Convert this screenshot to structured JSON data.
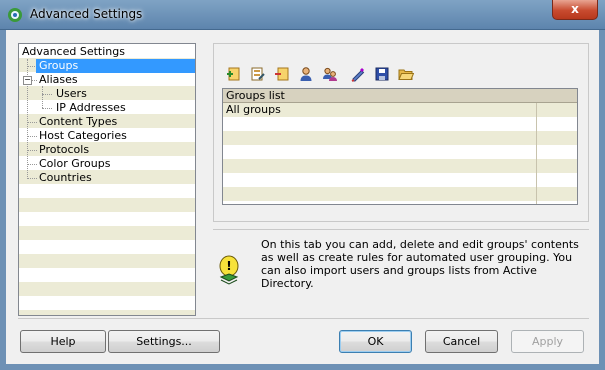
{
  "window": {
    "title": "Advanced Settings",
    "close_glyph": "x"
  },
  "tree": {
    "root": "Advanced Settings",
    "items": [
      {
        "label": "Groups",
        "selected": true
      },
      {
        "label": "Aliases",
        "expanded": true
      },
      {
        "label": "Users"
      },
      {
        "label": "IP Addresses"
      },
      {
        "label": "Content Types"
      },
      {
        "label": "Host Categories"
      },
      {
        "label": "Protocols"
      },
      {
        "label": "Color Groups"
      },
      {
        "label": "Countries"
      }
    ],
    "collapse_glyph": "−"
  },
  "toolbar": {
    "icons": [
      "add-icon",
      "edit-icon",
      "delete-icon",
      "user-icon",
      "user-group-icon",
      "pen-icon",
      "save-icon",
      "folder-open-icon"
    ]
  },
  "groups_list": {
    "header": "Groups list",
    "rows": [
      "All groups"
    ]
  },
  "info": {
    "text": "On this tab you can add, delete and edit groups' contents as well as create rules for automated user grouping. You can also import users and groups lists from Active Directory."
  },
  "buttons": {
    "help": "Help",
    "settings": "Settings...",
    "ok": "OK",
    "cancel": "Cancel",
    "apply": "Apply"
  },
  "colors": {
    "selection": "#3399ff",
    "alt_row": "#ecebd6",
    "title_bar": "#6e91b5",
    "close_button": "#c84b2f"
  }
}
